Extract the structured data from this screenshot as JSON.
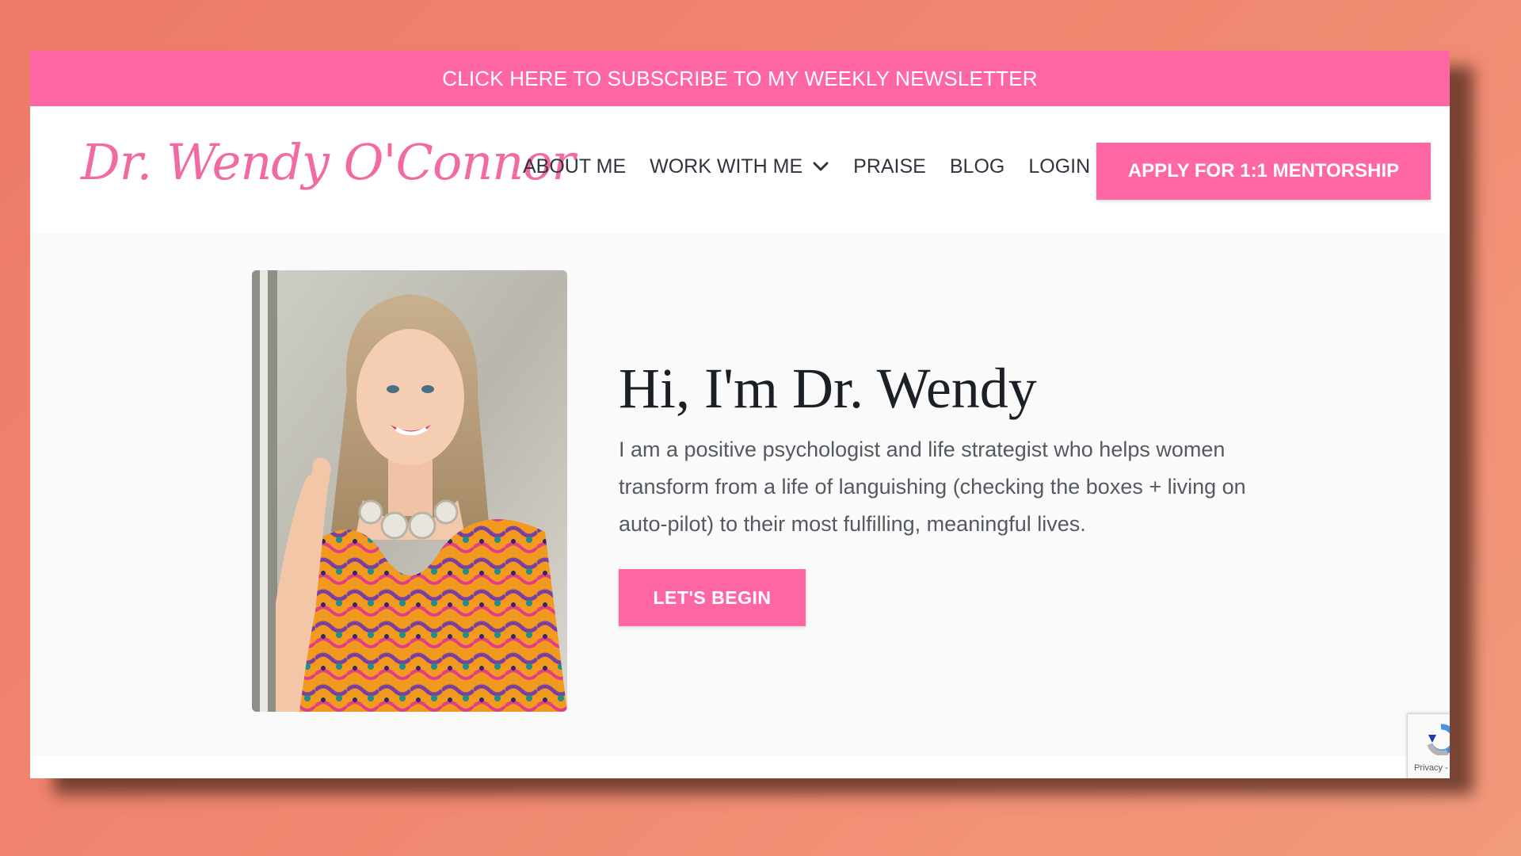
{
  "announcement": {
    "text": "CLICK HERE TO SUBSCRIBE TO MY WEEKLY NEWSLETTER"
  },
  "header": {
    "logo_text": "Dr. Wendy O'Connor",
    "nav": [
      {
        "label": "ABOUT ME"
      },
      {
        "label": "WORK WITH ME",
        "has_dropdown": true
      },
      {
        "label": "PRAISE"
      },
      {
        "label": "BLOG"
      },
      {
        "label": "LOGIN"
      }
    ],
    "cta_label": "APPLY FOR 1:1 MENTORSHIP"
  },
  "hero": {
    "title": "Hi, I'm Dr. Wendy",
    "description": "I am a positive psychologist and life strategist who helps women transform from a life of languishing (checking the boxes + living on auto-pilot) to their most fulfilling, meaningful lives.",
    "button_label": "LET'S BEGIN"
  },
  "recaptcha": {
    "label": "Privacy -"
  },
  "colors": {
    "brand_pink": "#ff66a4",
    "logo_pink": "#f26aa2",
    "background_coral": "#f08672",
    "heading": "#1b2026",
    "body_text": "#555a60"
  }
}
